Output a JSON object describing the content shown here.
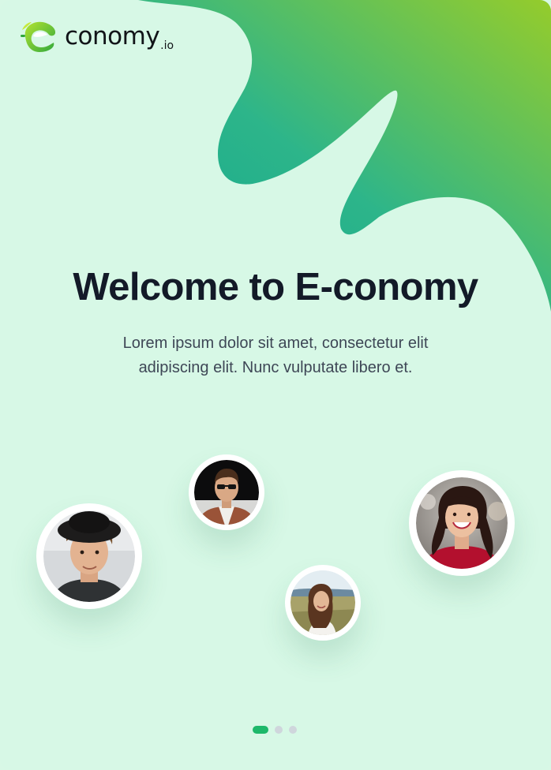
{
  "brand": {
    "name": "conomy",
    "tld": ".io",
    "logo_icon": "e-leaf-logo-icon"
  },
  "hero": {
    "title": "Welcome to E-conomy",
    "subtitle": "Lorem ipsum dolor sit amet, consectetur elit adipiscing elit. Nunc vulputate libero et."
  },
  "avatars": [
    {
      "name": "avatar-curly-hair-man-hat"
    },
    {
      "name": "avatar-sunglasses-man"
    },
    {
      "name": "avatar-woman-field"
    },
    {
      "name": "avatar-smiling-woman-red-top"
    }
  ],
  "pagination": {
    "total": 3,
    "active": 1
  },
  "colors": {
    "background": "#d7f8e6",
    "gradient_start": "#0fa68f",
    "gradient_end": "#8fcc2e",
    "accent": "#1db86a",
    "title": "#131a28",
    "body_text": "#3e4756"
  }
}
